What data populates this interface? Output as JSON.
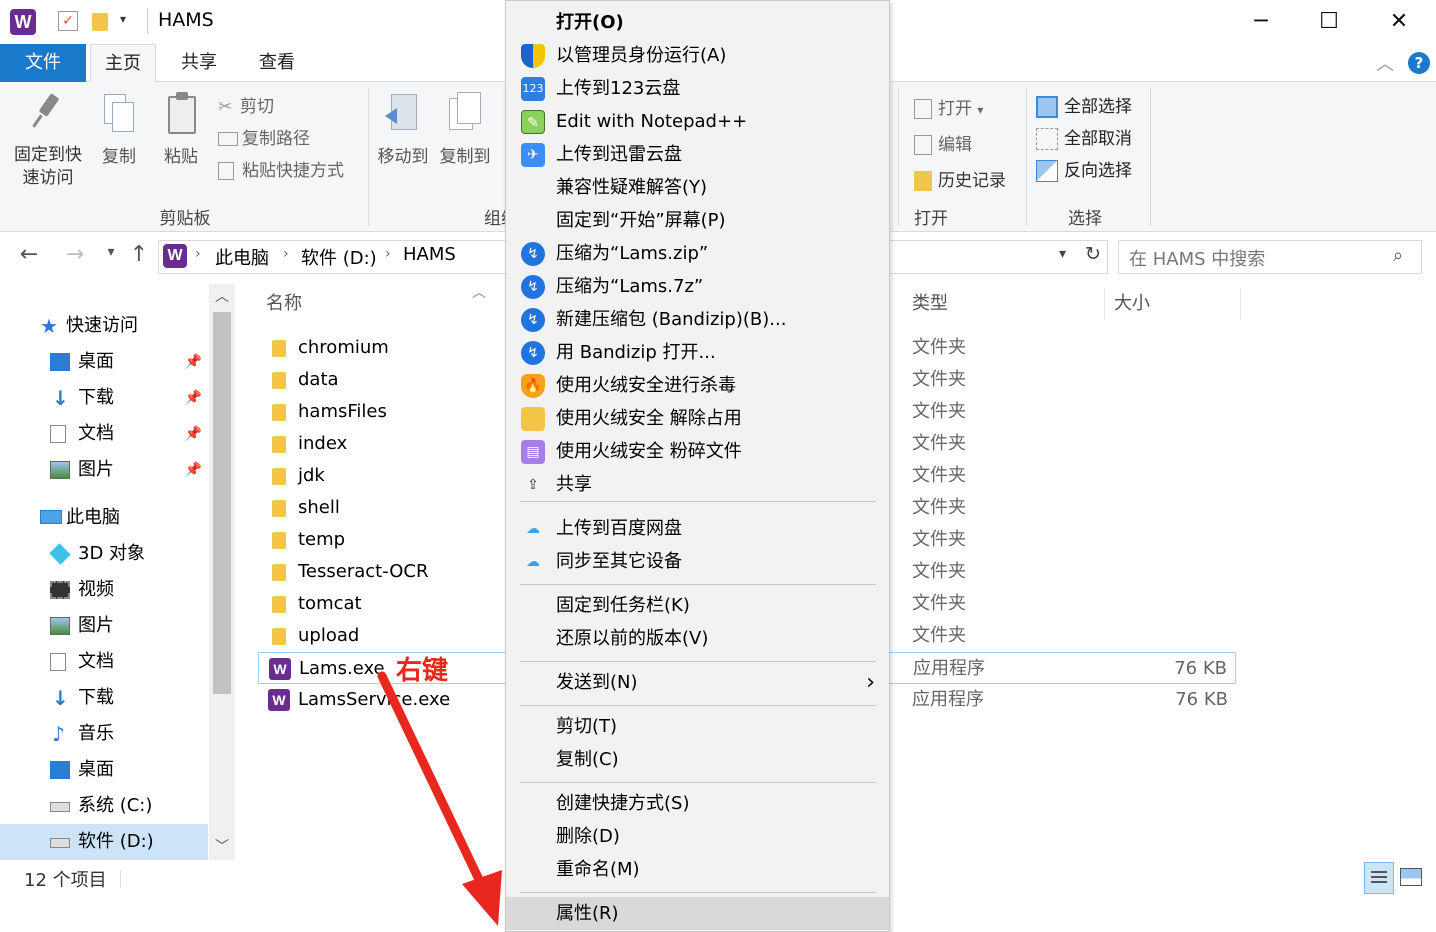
{
  "window": {
    "title": "HAMS",
    "logo_glyph": "W",
    "controls": {
      "minimize": "─",
      "maximize": "☐",
      "close": "✕"
    }
  },
  "tabs": [
    {
      "label": "文件"
    },
    {
      "label": "主页"
    },
    {
      "label": "共享"
    },
    {
      "label": "查看"
    }
  ],
  "ribbon": {
    "clipboard": {
      "pin_label_1": "固定到快",
      "pin_label_2": "速访问",
      "copy": "复制",
      "paste": "粘贴",
      "cut": "剪切",
      "copy_path": "复制路径",
      "paste_shortcut": "粘贴快捷方式",
      "group": "剪贴板"
    },
    "organize": {
      "move_to": "移动到",
      "copy_to": "复制到",
      "group": "组织"
    },
    "open": {
      "open": "打开",
      "edit": "编辑",
      "history": "历史记录",
      "group": "打开"
    },
    "select": {
      "select_all": "全部选择",
      "select_none": "全部取消",
      "invert": "反向选择",
      "group": "选择"
    }
  },
  "address": {
    "crumbs": [
      "此电脑",
      "软件 (D:)",
      "HAMS"
    ],
    "search_placeholder": "在 HAMS 中搜索"
  },
  "nav": {
    "quick_access": "快速访问",
    "quick_items": [
      "桌面",
      "下载",
      "文档",
      "图片"
    ],
    "this_pc": "此电脑",
    "pc_items": [
      "3D 对象",
      "视频",
      "图片",
      "文档",
      "下载",
      "音乐",
      "桌面",
      "系统 (C:)",
      "软件 (D:)"
    ]
  },
  "columns": {
    "name": "名称",
    "type": "类型",
    "size": "大小"
  },
  "files": [
    {
      "name": "chromium",
      "type": "文件夹",
      "size": "",
      "kind": "folder"
    },
    {
      "name": "data",
      "type": "文件夹",
      "size": "",
      "kind": "folder"
    },
    {
      "name": "hamsFiles",
      "type": "文件夹",
      "size": "",
      "kind": "folder"
    },
    {
      "name": "index",
      "type": "文件夹",
      "size": "",
      "kind": "folder"
    },
    {
      "name": "jdk",
      "type": "文件夹",
      "size": "",
      "kind": "folder"
    },
    {
      "name": "shell",
      "type": "文件夹",
      "size": "",
      "kind": "folder"
    },
    {
      "name": "temp",
      "type": "文件夹",
      "size": "",
      "kind": "folder"
    },
    {
      "name": "Tesseract-OCR",
      "type": "文件夹",
      "size": "",
      "kind": "folder"
    },
    {
      "name": "tomcat",
      "type": "文件夹",
      "size": "",
      "kind": "folder"
    },
    {
      "name": "upload",
      "type": "文件夹",
      "size": "",
      "kind": "folder"
    },
    {
      "name": "Lams.exe",
      "type": "应用程序",
      "size": "76 KB",
      "kind": "exe"
    },
    {
      "name": "LamsService.exe",
      "type": "应用程序",
      "size": "76 KB",
      "kind": "exe"
    }
  ],
  "status": {
    "count": "12 个项目"
  },
  "context_menu": {
    "items": [
      {
        "label": "打开(O)",
        "icon": "none"
      },
      {
        "label": "以管理员身份运行(A)",
        "icon": "shield-icon"
      },
      {
        "label": "上传到123云盘",
        "icon": "cloud-123-icon"
      },
      {
        "label": "Edit with Notepad++",
        "icon": "notepad-icon"
      },
      {
        "label": "上传到迅雷云盘",
        "icon": "xunlei-icon"
      },
      {
        "label": "兼容性疑难解答(Y)",
        "icon": "none"
      },
      {
        "label": "固定到“开始”屏幕(P)",
        "icon": "none"
      },
      {
        "label": "压缩为“Lams.zip”",
        "icon": "bandizip-icon"
      },
      {
        "label": "压缩为“Lams.7z”",
        "icon": "bandizip-icon"
      },
      {
        "label": "新建压缩包 (Bandizip)(B)...",
        "icon": "bandizip-icon"
      },
      {
        "label": "用 Bandizip 打开...",
        "icon": "bandizip-icon"
      },
      {
        "label": "使用火绒安全进行杀毒",
        "icon": "huorong-icon"
      },
      {
        "label": "使用火绒安全 解除占用",
        "icon": "folder-unlock-icon"
      },
      {
        "label": "使用火绒安全 粉碎文件",
        "icon": "shredder-icon"
      },
      {
        "label": "共享",
        "icon": "share-icon"
      },
      {
        "label": "上传到百度网盘",
        "icon": "baidu-icon"
      },
      {
        "label": "同步至其它设备",
        "icon": "baidu-icon"
      },
      {
        "label": "固定到任务栏(K)",
        "icon": "none"
      },
      {
        "label": "还原以前的版本(V)",
        "icon": "none"
      },
      {
        "label": "发送到(N)",
        "icon": "none"
      },
      {
        "label": "剪切(T)",
        "icon": "none"
      },
      {
        "label": "复制(C)",
        "icon": "none"
      },
      {
        "label": "创建快捷方式(S)",
        "icon": "none"
      },
      {
        "label": "删除(D)",
        "icon": "none"
      },
      {
        "label": "重命名(M)",
        "icon": "none"
      },
      {
        "label": "属性(R)",
        "icon": "none"
      }
    ]
  },
  "annotation": {
    "label": "右键",
    "color": "#e8281e"
  },
  "colors": {
    "accent": "#1979ca",
    "brand": "#6a2c91",
    "folder": "#f3c64a"
  }
}
